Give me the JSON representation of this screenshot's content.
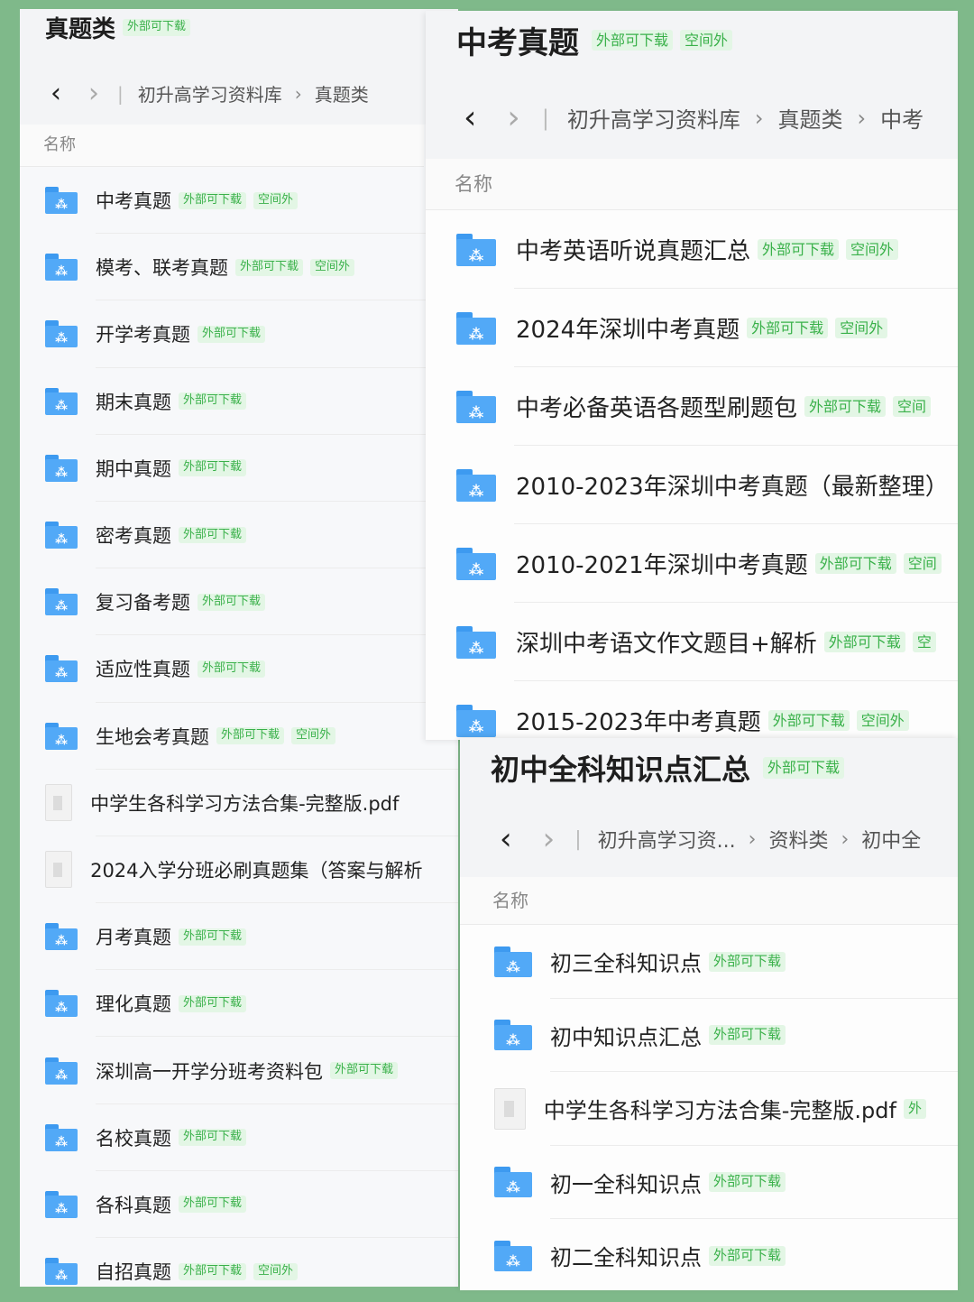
{
  "left": {
    "title": "真题类",
    "title_tags": [
      "外部可下载"
    ],
    "nav": {
      "back": "‹",
      "forward": "›",
      "crumbs": [
        "初升高学习资料库",
        "真题类"
      ]
    },
    "column_header": "名称",
    "rows": [
      {
        "name": "中考真题",
        "icon": "folder-icon",
        "tags": [
          "外部可下载",
          "空间外"
        ]
      },
      {
        "name": "模考、联考真题",
        "icon": "folder-icon",
        "tags": [
          "外部可下载",
          "空间外"
        ]
      },
      {
        "name": "开学考真题",
        "icon": "folder-icon",
        "tags": [
          "外部可下载"
        ]
      },
      {
        "name": "期末真题",
        "icon": "folder-icon",
        "tags": [
          "外部可下载"
        ]
      },
      {
        "name": "期中真题",
        "icon": "folder-icon",
        "tags": [
          "外部可下载"
        ]
      },
      {
        "name": "密考真题",
        "icon": "folder-icon",
        "tags": [
          "外部可下载"
        ]
      },
      {
        "name": "复习备考题",
        "icon": "folder-icon",
        "tags": [
          "外部可下载"
        ]
      },
      {
        "name": "适应性真题",
        "icon": "folder-icon",
        "tags": [
          "外部可下载"
        ]
      },
      {
        "name": "生地会考真题",
        "icon": "folder-icon",
        "tags": [
          "外部可下载",
          "空间外"
        ]
      },
      {
        "name": "中学生各科学习方法合集-完整版.pdf",
        "icon": "pdf-file-icon",
        "tags": []
      },
      {
        "name": "2024入学分班必刷真题集（答案与解析",
        "icon": "doc-file-icon",
        "tags": []
      },
      {
        "name": "月考真题",
        "icon": "folder-icon",
        "tags": [
          "外部可下载"
        ]
      },
      {
        "name": "理化真题",
        "icon": "folder-icon",
        "tags": [
          "外部可下载"
        ]
      },
      {
        "name": "深圳高一开学分班考资料包",
        "icon": "folder-icon",
        "tags": [
          "外部可下载"
        ]
      },
      {
        "name": "名校真题",
        "icon": "folder-icon",
        "tags": [
          "外部可下载"
        ]
      },
      {
        "name": "各科真题",
        "icon": "folder-icon",
        "tags": [
          "外部可下载"
        ]
      },
      {
        "name": "自招真题",
        "icon": "folder-icon",
        "tags": [
          "外部可下载",
          "空间外"
        ]
      }
    ]
  },
  "right_top": {
    "title": "中考真题",
    "title_tags": [
      "外部可下载",
      "空间外"
    ],
    "nav": {
      "back": "‹",
      "forward": "›",
      "crumbs": [
        "初升高学习资料库",
        "真题类",
        "中考"
      ]
    },
    "column_header": "名称",
    "rows": [
      {
        "name": "中考英语听说真题汇总",
        "icon": "folder-icon",
        "tags": [
          "外部可下载",
          "空间外"
        ]
      },
      {
        "name": "2024年深圳中考真题",
        "icon": "folder-icon",
        "tags": [
          "外部可下载",
          "空间外"
        ]
      },
      {
        "name": "中考必备英语各题型刷题包",
        "icon": "folder-icon",
        "tags": [
          "外部可下载",
          "空间"
        ]
      },
      {
        "name": "2010-2023年深圳中考真题（最新整理）",
        "icon": "folder-icon",
        "tags": []
      },
      {
        "name": "2010-2021年深圳中考真题",
        "icon": "folder-icon",
        "tags": [
          "外部可下载",
          "空间"
        ]
      },
      {
        "name": "深圳中考语文作文题目+解析",
        "icon": "folder-icon",
        "tags": [
          "外部可下载",
          "空"
        ]
      },
      {
        "name": "2015-2023年中考真题",
        "icon": "folder-icon",
        "tags": [
          "外部可下载",
          "空间外"
        ]
      }
    ]
  },
  "right_bottom": {
    "title": "初中全科知识点汇总",
    "title_tags": [
      "外部可下载"
    ],
    "nav": {
      "back": "‹",
      "forward": "›",
      "crumbs": [
        "初升高学习资...",
        "资料类",
        "初中全"
      ]
    },
    "column_header": "名称",
    "rows": [
      {
        "name": "初三全科知识点",
        "icon": "folder-icon",
        "tags": [
          "外部可下载"
        ]
      },
      {
        "name": "初中知识点汇总",
        "icon": "folder-icon",
        "tags": [
          "外部可下载"
        ]
      },
      {
        "name": "中学生各科学习方法合集-完整版.pdf",
        "icon": "pdf-file-icon",
        "tags": [
          "外"
        ]
      },
      {
        "name": "初一全科知识点",
        "icon": "folder-icon",
        "tags": [
          "外部可下载"
        ]
      },
      {
        "name": "初二全科知识点",
        "icon": "folder-icon",
        "tags": [
          "外部可下载"
        ]
      }
    ]
  }
}
